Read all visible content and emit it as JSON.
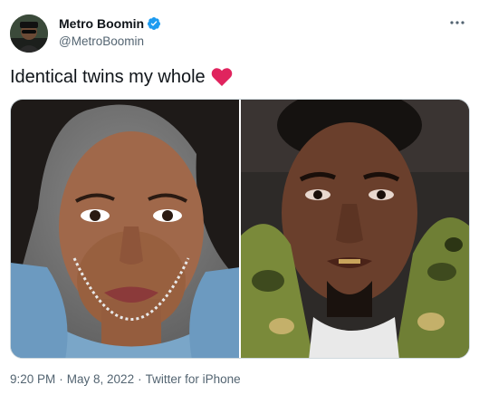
{
  "user": {
    "display_name": "Metro Boomin",
    "handle": "@MetroBoomin",
    "verified": true,
    "avatar_icon": "profile-avatar",
    "verified_icon": "verified-badge-icon",
    "verified_color": "#1d9bf0"
  },
  "menu": {
    "icon": "more-options-icon"
  },
  "tweet": {
    "text": "Identical twins my whole",
    "emoji": "red-heart"
  },
  "media": {
    "images": [
      {
        "name": "woman-portrait-photo"
      },
      {
        "name": "man-portrait-photo"
      }
    ]
  },
  "meta": {
    "time": "9:20 PM",
    "separator": "·",
    "date": "May 8, 2022",
    "source": "Twitter for iPhone"
  },
  "colors": {
    "text_primary": "#0f1419",
    "text_secondary": "#536471",
    "heart": "#e0245e",
    "border": "#cfd9de"
  }
}
